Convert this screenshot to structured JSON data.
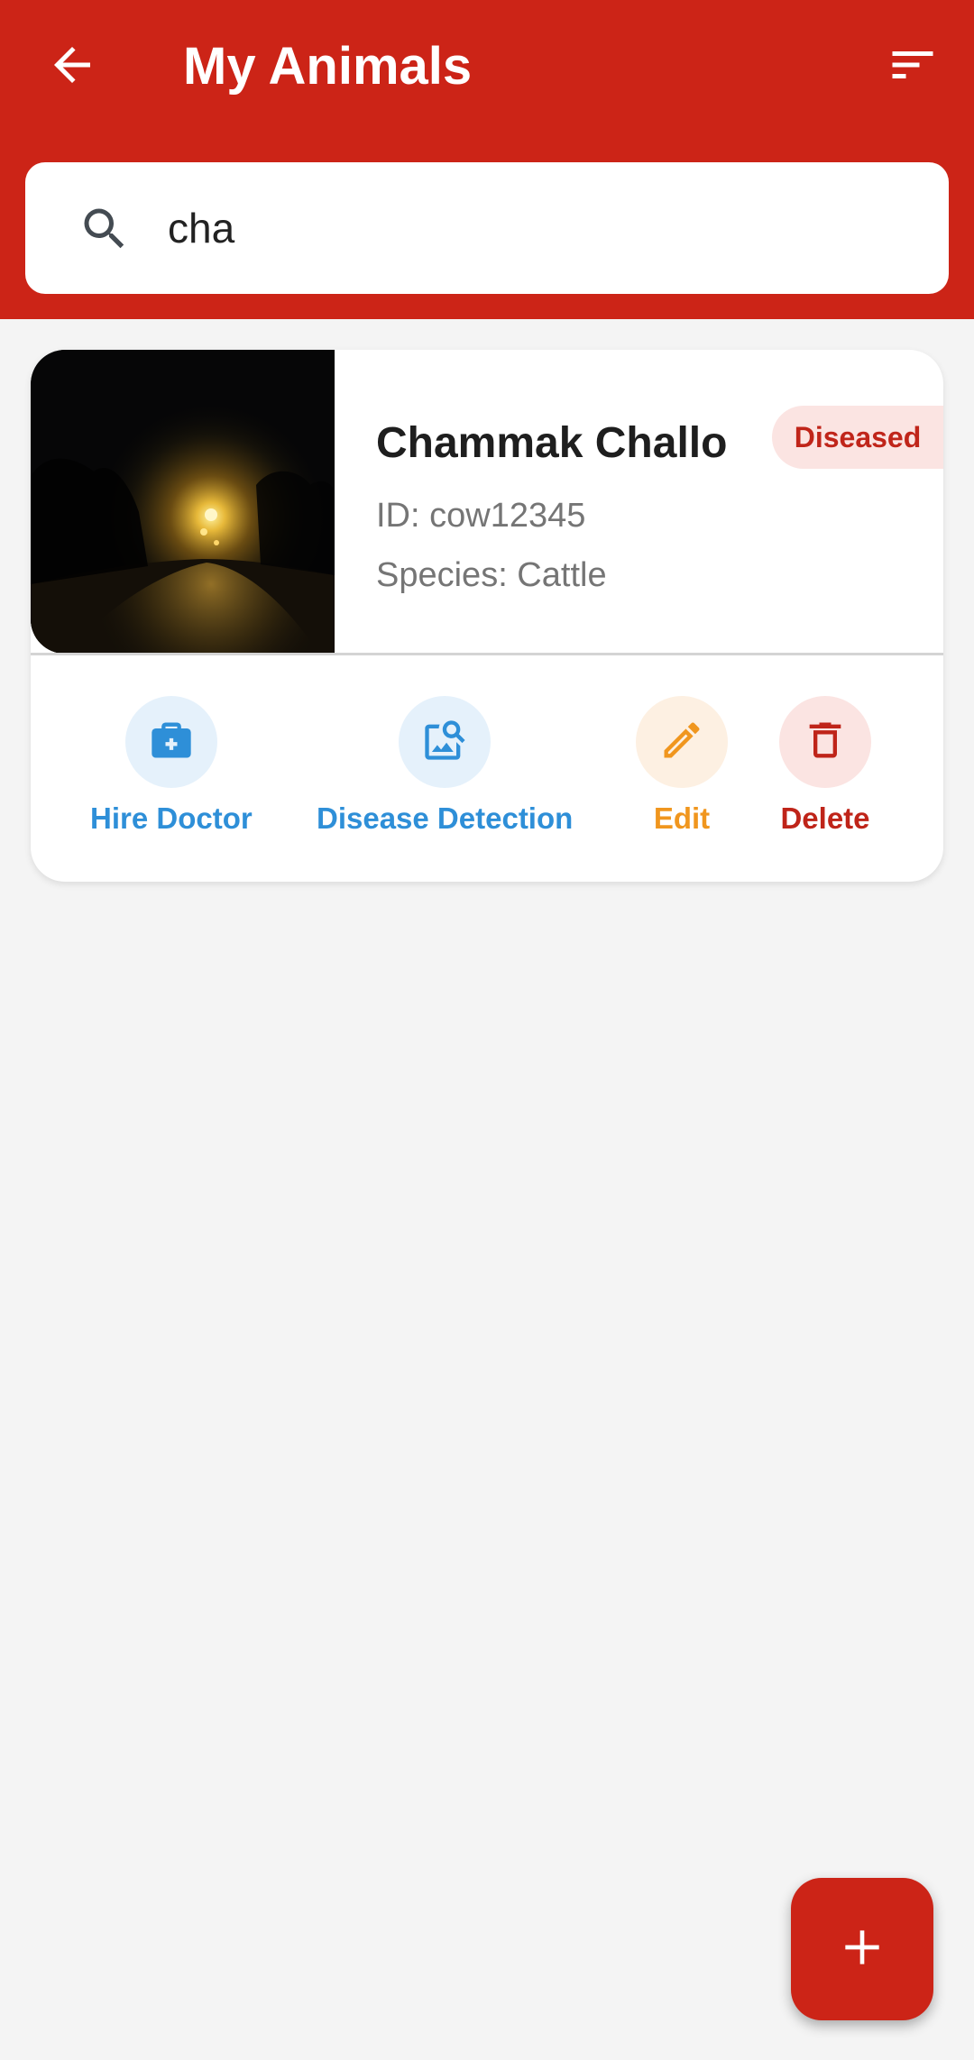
{
  "app_bar": {
    "title": "My Animals",
    "back_icon": "arrow-left-icon",
    "filter_icon": "sort-filter-icon",
    "background_color": "#cc2417"
  },
  "search": {
    "value": "cha",
    "icon": "search-icon"
  },
  "animal": {
    "name": "Chammak Challo",
    "status": "Diseased",
    "id_text": "ID: cow12345",
    "species_text": "Species: Cattle",
    "photo": "night-street-photo"
  },
  "actions": [
    {
      "label": "Hire Doctor",
      "icon": "medical-bag-icon",
      "color": "#2e8fd8",
      "bg": "#e5f1fb"
    },
    {
      "label": "Disease Detection",
      "icon": "image-search-icon",
      "color": "#2e8fd8",
      "bg": "#e5f1fb"
    },
    {
      "label": "Edit",
      "icon": "pencil-icon",
      "color": "#f0961e",
      "bg": "#fdf0e2"
    },
    {
      "label": "Delete",
      "icon": "trash-icon",
      "color": "#bf2419",
      "bg": "#fbe4e2"
    }
  ],
  "fab": {
    "icon": "plus-icon"
  }
}
